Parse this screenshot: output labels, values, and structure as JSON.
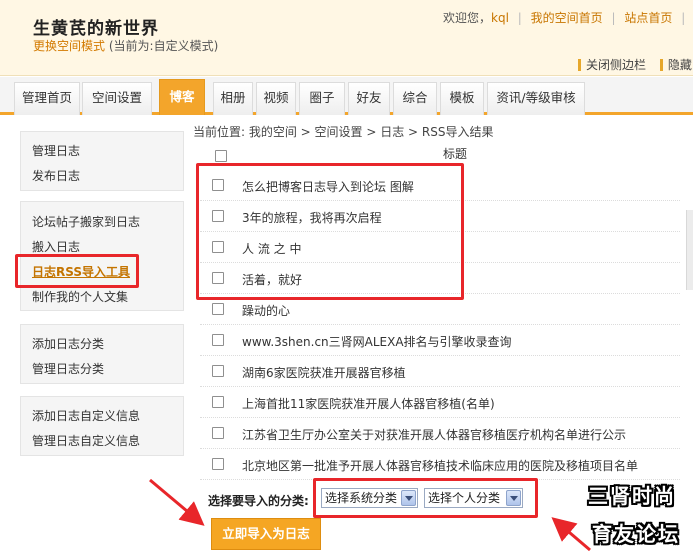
{
  "header": {
    "site_title": "生黄芪的新世界",
    "switch_mode_link": "更换空间模式",
    "current_mode": "(当前为:自定义模式)",
    "welcome": "欢迎您，",
    "username": "kql",
    "my_space": "我的空间首页",
    "site_home": "站点首页",
    "enter_cut": "进",
    "close_sidebar": "关闭侧边栏",
    "hide_cut": "隐藏"
  },
  "nav": {
    "items": [
      "管理首页",
      "空间设置",
      "博客",
      "相册",
      "视频",
      "圈子",
      "好友",
      "综合",
      "模板",
      "资讯/等级审核"
    ],
    "active": "博客"
  },
  "sidebar": {
    "group1": [
      "管理日志",
      "发布日志"
    ],
    "group2": [
      "论坛帖子搬家到日志",
      "搬入日志",
      "日志RSS导入工具",
      "制作我的个人文集"
    ],
    "group3": [
      "添加日志分类",
      "管理日志分类"
    ],
    "group4": [
      "添加日志自定义信息",
      "管理日志自定义信息"
    ]
  },
  "main": {
    "breadcrumb": "当前位置: 我的空间 > 空间设置 > 日志 > RSS导入结果",
    "col_title": "标题",
    "rows": [
      "怎么把博客日志导入到论坛 图解",
      "3年的旅程，我将再次启程",
      "人 流 之 中",
      "活着，就好",
      "躁动的心",
      "www.3shen.cn三肾网ALEXA排名与引擎收录查询",
      "湖南6家医院获准开展器官移植",
      "上海首批11家医院获准开展人体器官移植(名单)",
      "江苏省卫生厅办公室关于对获准开展人体器官移植医疗机构名单进行公示",
      "北京地区第一批准予开展人体器官移植技术临床应用的医院及移植项目名单"
    ],
    "category_label": "选择要导入的分类:",
    "system_category": "选择系统分类",
    "personal_category": "选择个人分类",
    "import_button": "立即导入为日志"
  },
  "watermark": {
    "line1": "三肾时尚",
    "line2": "育友论坛"
  },
  "colors": {
    "accent": "#f3a52b",
    "link": "#c87600",
    "annotation_red": "#e8262a"
  }
}
